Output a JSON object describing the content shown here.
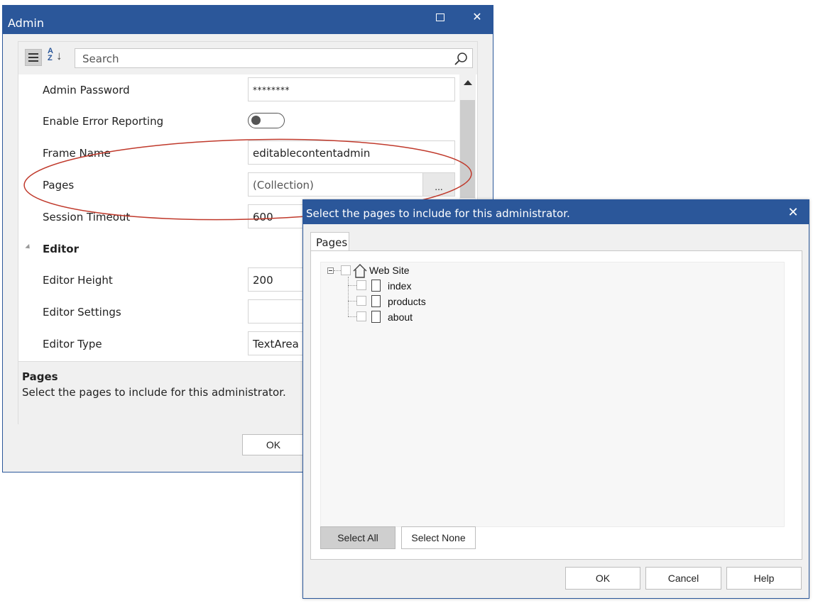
{
  "admin_window": {
    "title": "Admin",
    "maximize_icon": "maximize-icon",
    "close_icon": "close-icon",
    "search": {
      "placeholder": "Search"
    },
    "properties": [
      {
        "label": "Admin Password",
        "value": "********"
      },
      {
        "label": "Enable Error Reporting",
        "value": "off"
      },
      {
        "label": "Frame Name",
        "value": "editablecontentadmin"
      },
      {
        "label": "Pages",
        "value": "(Collection)",
        "button": "..."
      },
      {
        "label": "Session Timeout",
        "value": "600"
      },
      {
        "label": "Editor",
        "category": true
      },
      {
        "label": "Editor Height",
        "value": "200"
      },
      {
        "label": "Editor Settings",
        "value": ""
      },
      {
        "label": "Editor Type",
        "value": "TextArea"
      }
    ],
    "description": {
      "title": "Pages",
      "text": "Select the pages to include for this administrator."
    },
    "ok_label": "OK"
  },
  "pages_dialog": {
    "title": "Select the pages to include for this administrator.",
    "tab_label": "Pages",
    "tree": {
      "root": "Web Site",
      "children": [
        "index",
        "products",
        "about"
      ]
    },
    "select_all_label": "Select All",
    "select_none_label": "Select None",
    "ok_label": "OK",
    "cancel_label": "Cancel",
    "help_label": "Help"
  },
  "colors": {
    "title_bar": "#2b579a",
    "annotation_ellipse": "#c0392b"
  }
}
